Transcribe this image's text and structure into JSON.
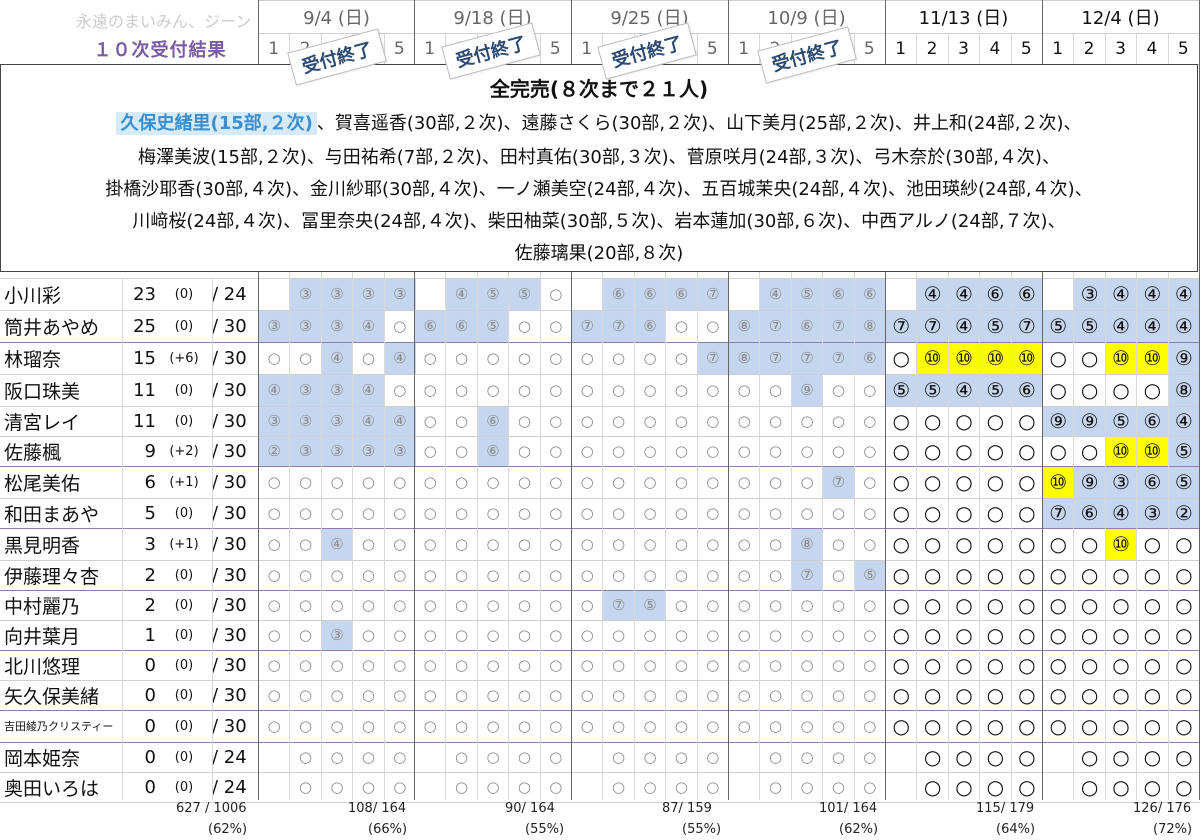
{
  "header": {
    "watermark": "永遠のまいみん、ジーン",
    "subtitle": "１０次受付結果",
    "dates": [
      "9/4 (日)",
      "9/18 (日)",
      "9/25 (日)",
      "10/9 (日)",
      "11/13 (日)",
      "12/4 (日)"
    ],
    "parts": [
      "1",
      "2",
      "3",
      "4",
      "5"
    ],
    "stamp": "受付終了"
  },
  "soldout": {
    "title": "全完売(８次まで２１人)",
    "highlight": "久保史緒里(15部,２次)",
    "line1_rest": "、賀喜遥香(30部,２次)、遠藤さくら(30部,２次)、山下美月(25部,２次)、井上和(24部,２次)、",
    "line2": "梅澤美波(15部,２次)、与田祐希(7部,２次)、田村真佑(30部,３次)、菅原咲月(24部,３次)、弓木奈於(30部,４次)、",
    "line3": "掛橋沙耶香(30部,４次)、金川紗耶(30部,４次)、一ノ瀬美空(24部,４次)、五百城茉央(24部,４次)、池田瑛紗(24部,４次)、",
    "line4": "川﨑桜(24部,４次)、冨里奈央(24部,４次)、柴田柚菜(30部,５次)、岩本蓮加(30部,６次)、中西アルノ(24部,７次)、",
    "line5": "佐藤璃果(20部,８次)"
  },
  "members": [
    {
      "name": "小川彩",
      "count": "23",
      "delta": "(0)",
      "total": "/ 24",
      "slots": [
        "",
        "3",
        "3",
        "3",
        "3",
        "",
        "4",
        "5",
        "5",
        "O",
        "",
        "6",
        "6",
        "6",
        "7",
        "",
        "4",
        "5",
        "6",
        "6",
        "",
        "4",
        "4",
        "6",
        "6",
        "",
        "3",
        "4",
        "4",
        "4"
      ]
    },
    {
      "name": "筒井あやめ",
      "count": "25",
      "delta": "(0)",
      "total": "/ 30",
      "slots": [
        "3",
        "3",
        "3",
        "4",
        "O",
        "6",
        "6",
        "5",
        "O",
        "O",
        "7",
        "7",
        "6",
        "O",
        "O",
        "8",
        "7",
        "6",
        "7",
        "8",
        "7",
        "7",
        "4",
        "5",
        "7",
        "5",
        "5",
        "4",
        "4",
        "4"
      ]
    },
    {
      "name": "林瑠奈",
      "count": "15",
      "delta": "(+6)",
      "total": "/ 30",
      "slots": [
        "O",
        "O",
        "4",
        "O",
        "4",
        "O",
        "O",
        "O",
        "O",
        "O",
        "O",
        "O",
        "O",
        "O",
        "7",
        "8",
        "7",
        "7",
        "7",
        "6",
        "O",
        "10",
        "10",
        "10",
        "10",
        "O",
        "O",
        "10",
        "10",
        "9"
      ]
    },
    {
      "name": "阪口珠美",
      "count": "11",
      "delta": "(0)",
      "total": "/ 30",
      "slots": [
        "4",
        "3",
        "3",
        "4",
        "O",
        "O",
        "O",
        "O",
        "O",
        "O",
        "O",
        "O",
        "O",
        "O",
        "O",
        "O",
        "O",
        "9",
        "O",
        "O",
        "5",
        "5",
        "4",
        "5",
        "6",
        "O",
        "O",
        "O",
        "O",
        "8"
      ]
    },
    {
      "name": "清宮レイ",
      "count": "11",
      "delta": "(0)",
      "total": "/ 30",
      "slots": [
        "3",
        "3",
        "3",
        "4",
        "4",
        "O",
        "O",
        "6",
        "O",
        "O",
        "O",
        "O",
        "O",
        "O",
        "O",
        "O",
        "O",
        "O",
        "O",
        "O",
        "O",
        "O",
        "O",
        "O",
        "O",
        "9",
        "9",
        "5",
        "6",
        "4"
      ]
    },
    {
      "name": "佐藤楓",
      "count": "9",
      "delta": "(+2)",
      "total": "/ 30",
      "slots": [
        "2",
        "3",
        "3",
        "3",
        "3",
        "O",
        "O",
        "6",
        "O",
        "O",
        "O",
        "O",
        "O",
        "O",
        "O",
        "O",
        "O",
        "O",
        "O",
        "O",
        "O",
        "O",
        "O",
        "O",
        "O",
        "O",
        "O",
        "10",
        "10",
        "5"
      ]
    },
    {
      "name": "松尾美佑",
      "count": "6",
      "delta": "(+1)",
      "total": "/ 30",
      "slots": [
        "O",
        "O",
        "O",
        "O",
        "O",
        "O",
        "O",
        "O",
        "O",
        "O",
        "O",
        "O",
        "O",
        "O",
        "O",
        "O",
        "O",
        "O",
        "7",
        "O",
        "O",
        "O",
        "O",
        "O",
        "O",
        "10",
        "9",
        "3",
        "6",
        "5"
      ]
    },
    {
      "name": "和田まあや",
      "count": "5",
      "delta": "(0)",
      "total": "/ 30",
      "slots": [
        "O",
        "O",
        "O",
        "O",
        "O",
        "O",
        "O",
        "O",
        "O",
        "O",
        "O",
        "O",
        "O",
        "O",
        "O",
        "O",
        "O",
        "O",
        "O",
        "O",
        "O",
        "O",
        "O",
        "O",
        "O",
        "7",
        "6",
        "4",
        "3",
        "2"
      ]
    },
    {
      "name": "黒見明香",
      "count": "3",
      "delta": "(+1)",
      "total": "/ 30",
      "slots": [
        "O",
        "O",
        "4",
        "O",
        "O",
        "O",
        "O",
        "O",
        "O",
        "O",
        "O",
        "O",
        "O",
        "O",
        "O",
        "O",
        "O",
        "8",
        "O",
        "O",
        "O",
        "O",
        "O",
        "O",
        "O",
        "O",
        "O",
        "10",
        "O",
        "O"
      ]
    },
    {
      "name": "伊藤理々杏",
      "count": "2",
      "delta": "(0)",
      "total": "/ 30",
      "slots": [
        "O",
        "O",
        "O",
        "O",
        "O",
        "O",
        "O",
        "O",
        "O",
        "O",
        "O",
        "O",
        "O",
        "O",
        "O",
        "O",
        "O",
        "7",
        "O",
        "5",
        "O",
        "O",
        "O",
        "O",
        "O",
        "O",
        "O",
        "O",
        "O",
        "O"
      ]
    },
    {
      "name": "中村麗乃",
      "count": "2",
      "delta": "(0)",
      "total": "/ 30",
      "slots": [
        "O",
        "O",
        "O",
        "O",
        "O",
        "O",
        "O",
        "O",
        "O",
        "O",
        "O",
        "7",
        "5",
        "O",
        "O",
        "O",
        "O",
        "O",
        "O",
        "O",
        "O",
        "O",
        "O",
        "O",
        "O",
        "O",
        "O",
        "O",
        "O",
        "O"
      ]
    },
    {
      "name": "向井葉月",
      "count": "1",
      "delta": "(0)",
      "total": "/ 30",
      "slots": [
        "O",
        "O",
        "3",
        "O",
        "O",
        "O",
        "O",
        "O",
        "O",
        "O",
        "O",
        "O",
        "O",
        "O",
        "O",
        "O",
        "O",
        "O",
        "O",
        "O",
        "O",
        "O",
        "O",
        "O",
        "O",
        "O",
        "O",
        "O",
        "O",
        "O"
      ]
    },
    {
      "name": "北川悠理",
      "count": "0",
      "delta": "(0)",
      "total": "/ 30",
      "slots": [
        "O",
        "O",
        "O",
        "O",
        "O",
        "O",
        "O",
        "O",
        "O",
        "O",
        "O",
        "O",
        "O",
        "O",
        "O",
        "O",
        "O",
        "O",
        "O",
        "O",
        "O",
        "O",
        "O",
        "O",
        "O",
        "O",
        "O",
        "O",
        "O",
        "O"
      ]
    },
    {
      "name": "矢久保美緒",
      "count": "0",
      "delta": "(0)",
      "total": "/ 30",
      "slots": [
        "O",
        "O",
        "O",
        "O",
        "O",
        "O",
        "O",
        "O",
        "O",
        "O",
        "O",
        "O",
        "O",
        "O",
        "O",
        "O",
        "O",
        "O",
        "O",
        "O",
        "O",
        "O",
        "O",
        "O",
        "O",
        "O",
        "O",
        "O",
        "O",
        "O"
      ]
    },
    {
      "name": "吉田綾乃クリスティー",
      "count": "0",
      "delta": "(0)",
      "total": "/ 30",
      "small": true,
      "slots": [
        "O",
        "O",
        "O",
        "O",
        "O",
        "O",
        "O",
        "O",
        "O",
        "O",
        "O",
        "O",
        "O",
        "O",
        "O",
        "O",
        "O",
        "O",
        "O",
        "O",
        "O",
        "O",
        "O",
        "O",
        "O",
        "O",
        "O",
        "O",
        "O",
        "O"
      ]
    },
    {
      "name": "岡本姫奈",
      "count": "0",
      "delta": "(0)",
      "total": "/ 24",
      "slots": [
        "",
        "O",
        "O",
        "O",
        "O",
        "",
        "O",
        "O",
        "O",
        "O",
        "",
        "O",
        "O",
        "O",
        "O",
        "",
        "O",
        "O",
        "O",
        "O",
        "",
        "O",
        "O",
        "O",
        "O",
        "",
        "O",
        "O",
        "O",
        "O"
      ]
    },
    {
      "name": "奥田いろは",
      "count": "0",
      "delta": "(0)",
      "total": "/ 24",
      "slots": [
        "",
        "O",
        "O",
        "O",
        "O",
        "",
        "O",
        "O",
        "O",
        "O",
        "",
        "O",
        "O",
        "O",
        "O",
        "",
        "O",
        "O",
        "O",
        "O",
        "",
        "O",
        "O",
        "O",
        "O",
        "",
        "O",
        "O",
        "O",
        "O"
      ]
    }
  ],
  "footer": {
    "overall": "627 / 1006",
    "overall_pct": "(62%)",
    "groups": [
      {
        "frac": "108/ 164",
        "pct": "(66%)"
      },
      {
        "frac": "90/ 164",
        "pct": "(55%)"
      },
      {
        "frac": "87/ 159",
        "pct": "(55%)"
      },
      {
        "frac": "101/ 164",
        "pct": "(62%)"
      },
      {
        "frac": "115/ 179",
        "pct": "(64%)"
      },
      {
        "frac": "126/ 176",
        "pct": "(72%)"
      }
    ]
  }
}
